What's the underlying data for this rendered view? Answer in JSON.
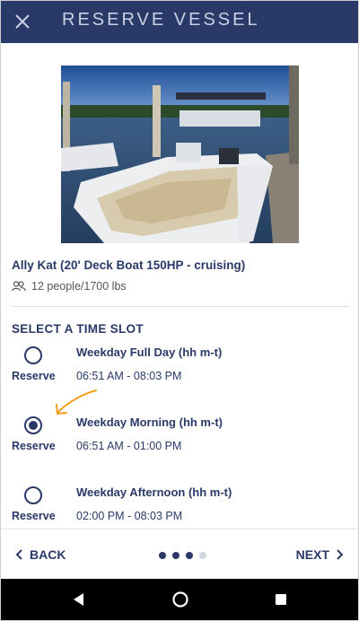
{
  "header": {
    "title": "RESERVE VESSEL",
    "close_icon": "close-icon"
  },
  "vessel": {
    "name": "Ally Kat (20' Deck Boat 150HP - cruising)",
    "capacity": "12 people/1700 lbs",
    "capacity_icon": "people-icon"
  },
  "section_title": "SELECT A TIME SLOT",
  "slots": [
    {
      "name": "Weekday Full Day (hh m-t)",
      "time": "06:51 AM - 08:03 PM",
      "reserve_label": "Reserve",
      "selected": false
    },
    {
      "name": "Weekday Morning (hh m-t)",
      "time": "06:51 AM - 01:00 PM",
      "reserve_label": "Reserve",
      "selected": true
    },
    {
      "name": "Weekday Afternoon (hh m-t)",
      "time": "02:00 PM - 08:03 PM",
      "reserve_label": "Reserve",
      "selected": false
    }
  ],
  "footer": {
    "back_label": "BACK",
    "next_label": "NEXT",
    "pagination": {
      "total": 4,
      "current": 3
    }
  },
  "colors": {
    "primary": "#2a3a68",
    "header_text": "#c9d0e3",
    "annotation_arrow": "#f2a01e",
    "inactive_dot": "#cfd4df"
  },
  "system_nav": {
    "back_icon": "nav-back-icon",
    "home_icon": "nav-home-icon",
    "recents_icon": "nav-recents-icon"
  }
}
